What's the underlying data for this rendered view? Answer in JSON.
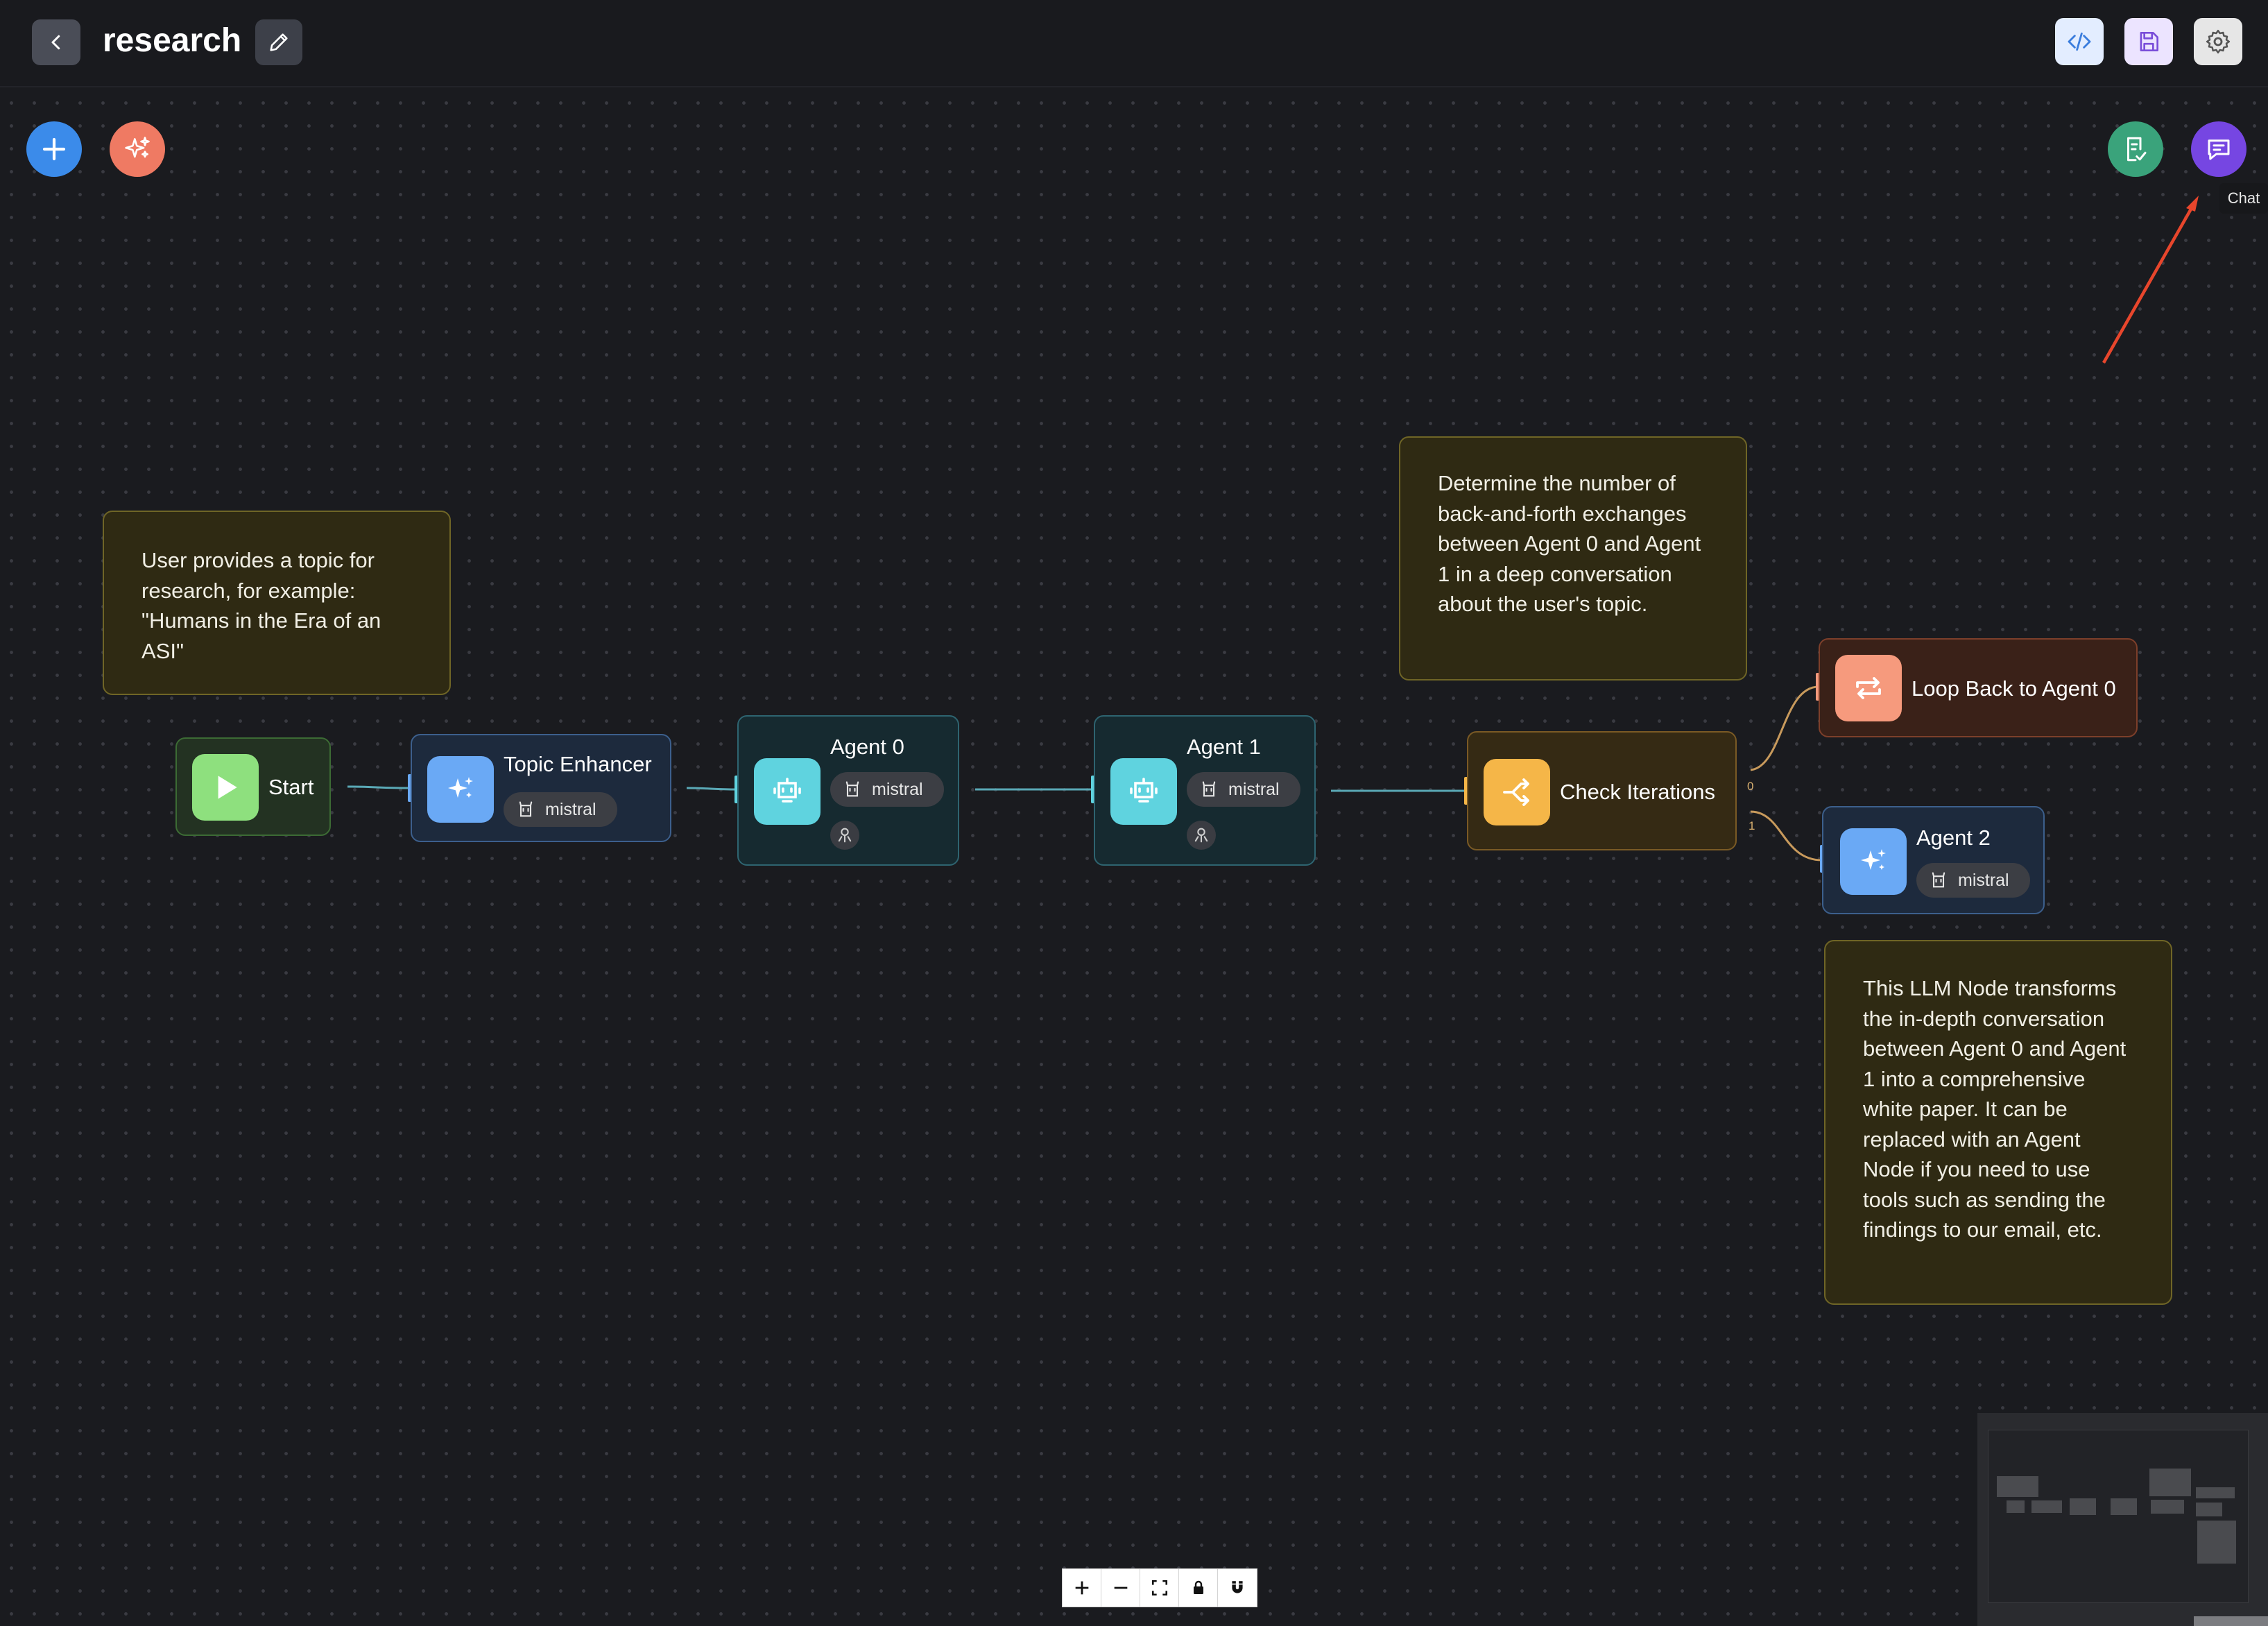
{
  "header": {
    "title": "research",
    "back_icon": "chevron-left-icon",
    "edit_icon": "pencil-icon",
    "actions": [
      {
        "name": "code-button",
        "icon": "code-icon",
        "bg": "#e3edff"
      },
      {
        "name": "save-button",
        "icon": "save-icon",
        "bg": "#ece4ff"
      },
      {
        "name": "settings-button",
        "icon": "gear-icon",
        "bg": "#e6e6e6"
      }
    ]
  },
  "canvas_controls": {
    "add_node_color": "#3b8bea",
    "generate_color": "#ef7a63",
    "validate_color": "#3aa37b",
    "chat_color": "#7646e2",
    "chat_tooltip": "Chat"
  },
  "notes": {
    "topic_note": "User provides a topic for research, for example: \"Humans in the Era of an ASI\"",
    "iterations_note": "Determine the number of back-and-forth exchanges between Agent 0 and Agent 1 in a deep conversation about the user's topic.",
    "llm_note": "This LLM Node transforms the in-depth conversation between Agent 0 and Agent 1 into a comprehensive white paper. It can be replaced with an Agent Node if you need to use tools such as sending the findings to our email, etc."
  },
  "nodes": {
    "start": {
      "title": "Start",
      "icon": "play-icon",
      "color": "#8ee07e"
    },
    "topic_enhancer": {
      "title": "Topic Enhancer",
      "model": "mistral",
      "icon": "sparkle-icon",
      "color": "#6aa9f5"
    },
    "agent0": {
      "title": "Agent 0",
      "model": "mistral",
      "icon": "robot-icon",
      "color": "#5fd3df"
    },
    "agent1": {
      "title": "Agent 1",
      "model": "mistral",
      "icon": "robot-icon",
      "color": "#5fd3df"
    },
    "check_iterations": {
      "title": "Check Iterations",
      "icon": "split-icon",
      "color": "#f5b648"
    },
    "loop_back": {
      "title": "Loop Back to Agent 0",
      "icon": "repeat-icon",
      "color": "#f69a7d"
    },
    "agent2": {
      "title": "Agent 2",
      "model": "mistral",
      "icon": "sparkle-icon",
      "color": "#6aa9f5"
    }
  },
  "edge_labels": {
    "branch0": "0",
    "branch1": "1"
  },
  "zoom_controls": [
    {
      "name": "zoom-in-button",
      "icon": "plus-icon"
    },
    {
      "name": "zoom-out-button",
      "icon": "minus-icon"
    },
    {
      "name": "fit-view-button",
      "icon": "fit-view-icon"
    },
    {
      "name": "lock-button",
      "icon": "lock-icon"
    },
    {
      "name": "snap-button",
      "icon": "magnet-icon"
    }
  ]
}
